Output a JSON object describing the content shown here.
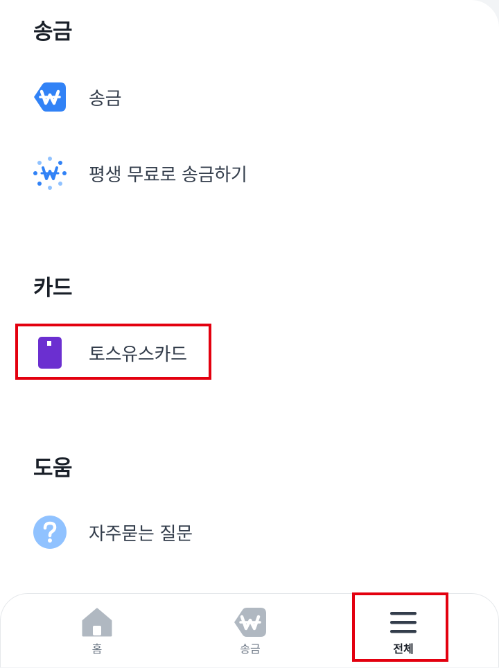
{
  "sections": {
    "transfer": {
      "title": "송금",
      "items": [
        {
          "label": "송금",
          "icon": "won-badge-icon"
        },
        {
          "label": "평생 무료로 송금하기",
          "icon": "won-sparkle-icon"
        }
      ]
    },
    "card": {
      "title": "카드",
      "items": [
        {
          "label": "토스유스카드",
          "icon": "purple-card-icon"
        }
      ]
    },
    "help": {
      "title": "도움",
      "items": [
        {
          "label": "자주묻는 질문",
          "icon": "question-icon"
        }
      ]
    }
  },
  "bottom_nav": {
    "items": [
      {
        "label": "홈",
        "icon": "home-icon",
        "active": false
      },
      {
        "label": "송금",
        "icon": "won-badge-icon",
        "active": false
      },
      {
        "label": "전체",
        "icon": "menu-icon",
        "active": true
      }
    ]
  },
  "colors": {
    "blue": "#3182f6",
    "light_blue": "#90c2ff",
    "purple": "#6b2fd0",
    "highlight_red": "#e3000f",
    "nav_gray": "#b0b8c1"
  }
}
